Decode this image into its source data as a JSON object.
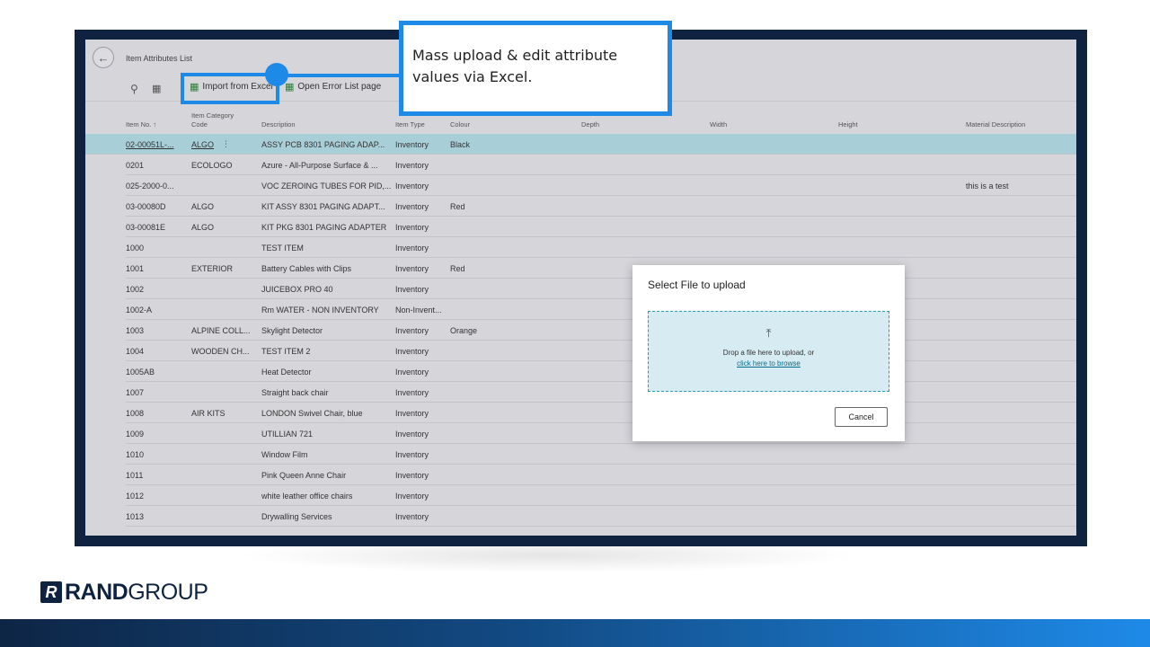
{
  "page": {
    "title": "Item Attributes List",
    "toolbar": {
      "import_label": "Import from Excel",
      "error_label": "Open Error List page"
    }
  },
  "columns": {
    "item_no": "Item No. ↑",
    "category_line1": "Item Category",
    "category_line2": "Code",
    "description": "Description",
    "item_type": "Item Type",
    "colour": "Colour",
    "depth": "Depth",
    "width": "Width",
    "height": "Height",
    "material": "Material Description"
  },
  "rows": [
    {
      "no": "02-00051L-...",
      "cat": "ALGO",
      "desc": "ASSY PCB 8301 PAGING ADAP...",
      "type": "Inventory",
      "colour": "Black",
      "mat": ""
    },
    {
      "no": "0201",
      "cat": "ECOLOGO",
      "desc": "Azure - All-Purpose Surface & ...",
      "type": "Inventory",
      "colour": "",
      "mat": ""
    },
    {
      "no": "025-2000-0...",
      "cat": "",
      "desc": "VOC ZEROING TUBES FOR PID,...",
      "type": "Inventory",
      "colour": "",
      "mat": "this is a test"
    },
    {
      "no": "03-00080D",
      "cat": "ALGO",
      "desc": "KIT ASSY 8301 PAGING ADAPT...",
      "type": "Inventory",
      "colour": "Red",
      "mat": ""
    },
    {
      "no": "03-00081E",
      "cat": "ALGO",
      "desc": "KIT PKG 8301 PAGING ADAPTER",
      "type": "Inventory",
      "colour": "",
      "mat": ""
    },
    {
      "no": "1000",
      "cat": "",
      "desc": "TEST ITEM",
      "type": "Inventory",
      "colour": "",
      "mat": ""
    },
    {
      "no": "1001",
      "cat": "EXTERIOR",
      "desc": "Battery Cables with Clips",
      "type": "Inventory",
      "colour": "Red",
      "mat": ""
    },
    {
      "no": "1002",
      "cat": "",
      "desc": "JUICEBOX PRO 40",
      "type": "Inventory",
      "colour": "",
      "mat": ""
    },
    {
      "no": "1002-A",
      "cat": "",
      "desc": "Rm WATER - NON INVENTORY",
      "type": "Non-Invent...",
      "colour": "",
      "mat": ""
    },
    {
      "no": "1003",
      "cat": "ALPINE COLL...",
      "desc": "Skylight Detector",
      "type": "Inventory",
      "colour": "Orange",
      "mat": ""
    },
    {
      "no": "1004",
      "cat": "WOODEN CH...",
      "desc": "TEST ITEM 2",
      "type": "Inventory",
      "colour": "",
      "mat": ""
    },
    {
      "no": "1005AB",
      "cat": "",
      "desc": "Heat Detector",
      "type": "Inventory",
      "colour": "",
      "mat": ""
    },
    {
      "no": "1007",
      "cat": "",
      "desc": "Straight back chair",
      "type": "Inventory",
      "colour": "",
      "mat": ""
    },
    {
      "no": "1008",
      "cat": "AIR KITS",
      "desc": "LONDON Swivel Chair, blue",
      "type": "Inventory",
      "colour": "",
      "mat": ""
    },
    {
      "no": "1009",
      "cat": "",
      "desc": "UTILLIAN 721",
      "type": "Inventory",
      "colour": "",
      "mat": ""
    },
    {
      "no": "1010",
      "cat": "",
      "desc": "Window Film",
      "type": "Inventory",
      "colour": "",
      "mat": ""
    },
    {
      "no": "1011",
      "cat": "",
      "desc": "Pink Queen Anne Chair",
      "type": "Inventory",
      "colour": "",
      "mat": ""
    },
    {
      "no": "1012",
      "cat": "",
      "desc": "white leather office chairs",
      "type": "Inventory",
      "colour": "",
      "mat": ""
    },
    {
      "no": "1013",
      "cat": "",
      "desc": "Drywalling Services",
      "type": "Inventory",
      "colour": "",
      "mat": ""
    }
  ],
  "callout": {
    "text": "Mass upload & edit attribute values via Excel."
  },
  "modal": {
    "title": "Select File to upload",
    "drop_text": "Drop a file here to upload, or",
    "browse_link": "click here to browse",
    "cancel_label": "Cancel"
  },
  "brand": {
    "mark": "R",
    "name_bold": "RAND",
    "name_light": "GROUP"
  },
  "icons": {
    "back": "arrow-left",
    "search": "magnifier",
    "filter": "filter-pane",
    "excel": "excel-grid",
    "upload": "upload-arrow"
  },
  "colors": {
    "accent": "#1e8ae8",
    "frame": "#0f2340",
    "selected_row": "#a8cfd8",
    "dropzone": "#d7ecf2"
  }
}
